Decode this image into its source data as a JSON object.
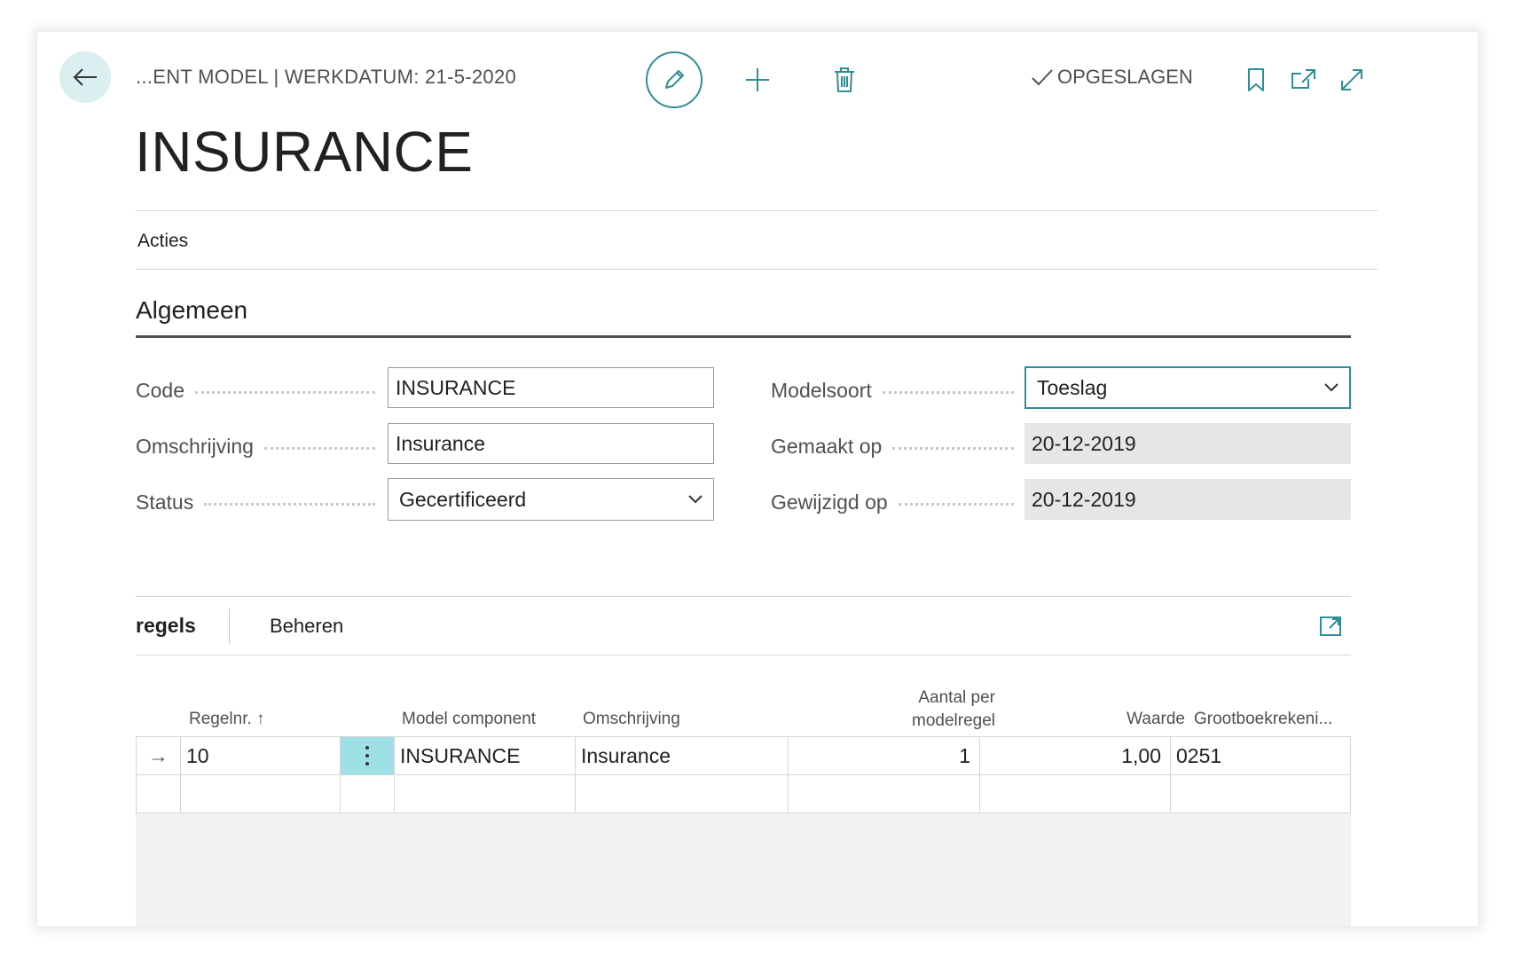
{
  "header": {
    "breadcrumb": "...ENT MODEL | WERKDATUM: 21-5-2020",
    "saved_label": "OPGESLAGEN",
    "icons": [
      "back-arrow-icon",
      "pencil-icon",
      "plus-icon",
      "trash-icon",
      "checkmark-icon",
      "bookmark-icon",
      "open-new-window-icon",
      "expand-icon"
    ]
  },
  "page": {
    "title": "INSURANCE",
    "actions_label": "Acties"
  },
  "general": {
    "section_title": "Algemeen",
    "fields": {
      "code": {
        "label": "Code",
        "value": "INSURANCE"
      },
      "description": {
        "label": "Omschrijving",
        "value": "Insurance"
      },
      "status": {
        "label": "Status",
        "value": "Gecertificeerd"
      },
      "model_type": {
        "label": "Modelsoort",
        "value": "Toeslag"
      },
      "created_on": {
        "label": "Gemaakt op",
        "value": "20-12-2019"
      },
      "modified_on": {
        "label": "Gewijzigd op",
        "value": "20-12-2019"
      }
    }
  },
  "lines": {
    "tab_active": "regels",
    "tab_manage": "Beheren",
    "columns": {
      "line_no": "Regelnr. ↑",
      "model_component": "Model component",
      "description": "Omschrijving",
      "qty_line1": "Aantal per",
      "qty_line2": "modelregel",
      "value": "Waarde",
      "gl_account": "Grootboekrekeni..."
    },
    "rows": [
      {
        "indicator": "→",
        "line_no": "10",
        "model_component": "INSURANCE",
        "description": "Insurance",
        "qty": "1",
        "value": "1,00",
        "gl_account": "0251"
      }
    ]
  },
  "colors": {
    "accent": "#2e8e96",
    "accent_light": "#dbeef0",
    "selected_cell": "#9ee0e6",
    "readonly_bg": "#e6e6e6"
  }
}
